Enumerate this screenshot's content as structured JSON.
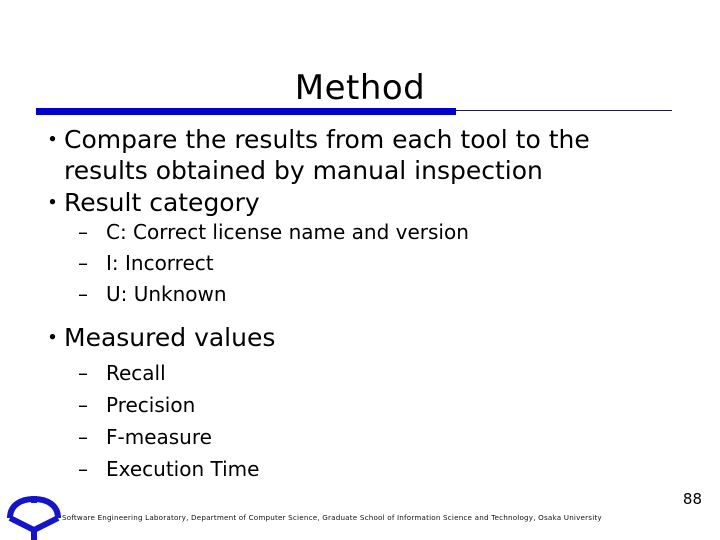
{
  "slide": {
    "title": "Method",
    "page_number": "88",
    "accent_color": "#0000CC",
    "rule_color": "#1A1A3C",
    "background_color": "#FFFFFF",
    "text_color": "#000000"
  },
  "bullets": [
    {
      "marker": "・",
      "text": "Compare the results from each tool to the results obtained by manual inspection",
      "sub": []
    },
    {
      "marker": "・",
      "text": "Result category",
      "sub": [
        {
          "marker": "–",
          "text": "C: Correct license name and version"
        },
        {
          "marker": "–",
          "text": "I: Incorrect"
        },
        {
          "marker": "–",
          "text": "U: Unknown"
        }
      ]
    },
    {
      "marker": "・",
      "text": "Measured values",
      "sub": [
        {
          "marker": "–",
          "text": "Recall"
        },
        {
          "marker": "–",
          "text": "Precision"
        },
        {
          "marker": "–",
          "text": "F-measure"
        },
        {
          "marker": "–",
          "text": "Execution Time"
        }
      ]
    }
  ],
  "footer": {
    "text": "Software Engineering Laboratory, Department of Computer Science, Graduate School of Information Science and Technology, Osaka University",
    "logo_name": "osaka-university-crest",
    "logo_color": "#1414C8"
  }
}
